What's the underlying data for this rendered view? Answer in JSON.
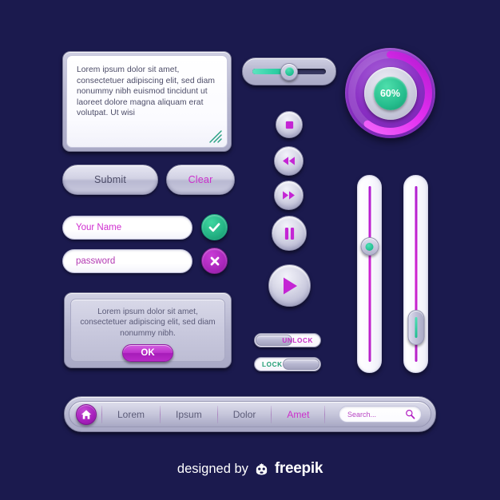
{
  "background_color": "#1b1a4e",
  "accent_magenta": "#cc2ecc",
  "accent_green": "#23b183",
  "textarea": {
    "text": "Lorem ipsum dolor sit amet, consectetuer adipiscing elit, sed diam nonummy nibh euismod tincidunt ut laoreet dolore magna aliquam erat volutpat. Ut wisi",
    "resize_handle_icon": "resize-grip-icon"
  },
  "buttons": {
    "submit_label": "Submit",
    "clear_label": "Clear",
    "ok_label": "OK"
  },
  "fields": {
    "name_value": "Your Name",
    "name_placeholder": "Your Name",
    "password_value": "password",
    "password_placeholder": "password",
    "confirm_icon": "check-icon",
    "cancel_icon": "close-icon"
  },
  "dialog": {
    "text": "Lorem ipsum dolor sit amet, consectetuer adipiscing elit, sed diam nonummy nibh."
  },
  "horizontal_slider": {
    "value_percent": 50,
    "fill_color": "#2fcfa5",
    "track_color": "#32325a"
  },
  "media_controls": [
    {
      "name": "stop-button",
      "icon": "stop-icon"
    },
    {
      "name": "rewind-button",
      "icon": "rewind-icon"
    },
    {
      "name": "forward-button",
      "icon": "fast-forward-icon"
    },
    {
      "name": "pause-button",
      "icon": "pause-icon"
    },
    {
      "name": "play-button",
      "icon": "play-icon"
    }
  ],
  "progress_dial": {
    "value_label": "60%",
    "value_percent": 60,
    "arc_color": "#e040f0",
    "ring_color": "#8a2fc4",
    "value_bg_color": "#25bd8d"
  },
  "vertical_sliders": [
    {
      "name": "vslider-1",
      "value_percent": 65,
      "knob": "round",
      "track_color": "#cf23d0"
    },
    {
      "name": "vslider-2",
      "value_percent": 22,
      "knob": "pill",
      "track_color": "#cf23d0"
    }
  ],
  "toggles": [
    {
      "name": "toggle-unlock",
      "label": "UNLOCK",
      "state": "off",
      "label_color": "#c72ec7"
    },
    {
      "name": "toggle-lock",
      "label": "LOCK",
      "state": "on",
      "label_color": "#1f9d73"
    }
  ],
  "navbar": {
    "home_icon": "home-icon",
    "items": [
      {
        "label": "Lorem",
        "active": false
      },
      {
        "label": "Ipsum",
        "active": false
      },
      {
        "label": "Dolor",
        "active": false
      },
      {
        "label": "Amet",
        "active": true
      }
    ],
    "search": {
      "placeholder": "Search...",
      "value": "Search...",
      "icon": "search-icon"
    }
  },
  "footer": {
    "text": "designed by",
    "brand": "freepik",
    "logo_icon": "freepik-logo-icon"
  }
}
